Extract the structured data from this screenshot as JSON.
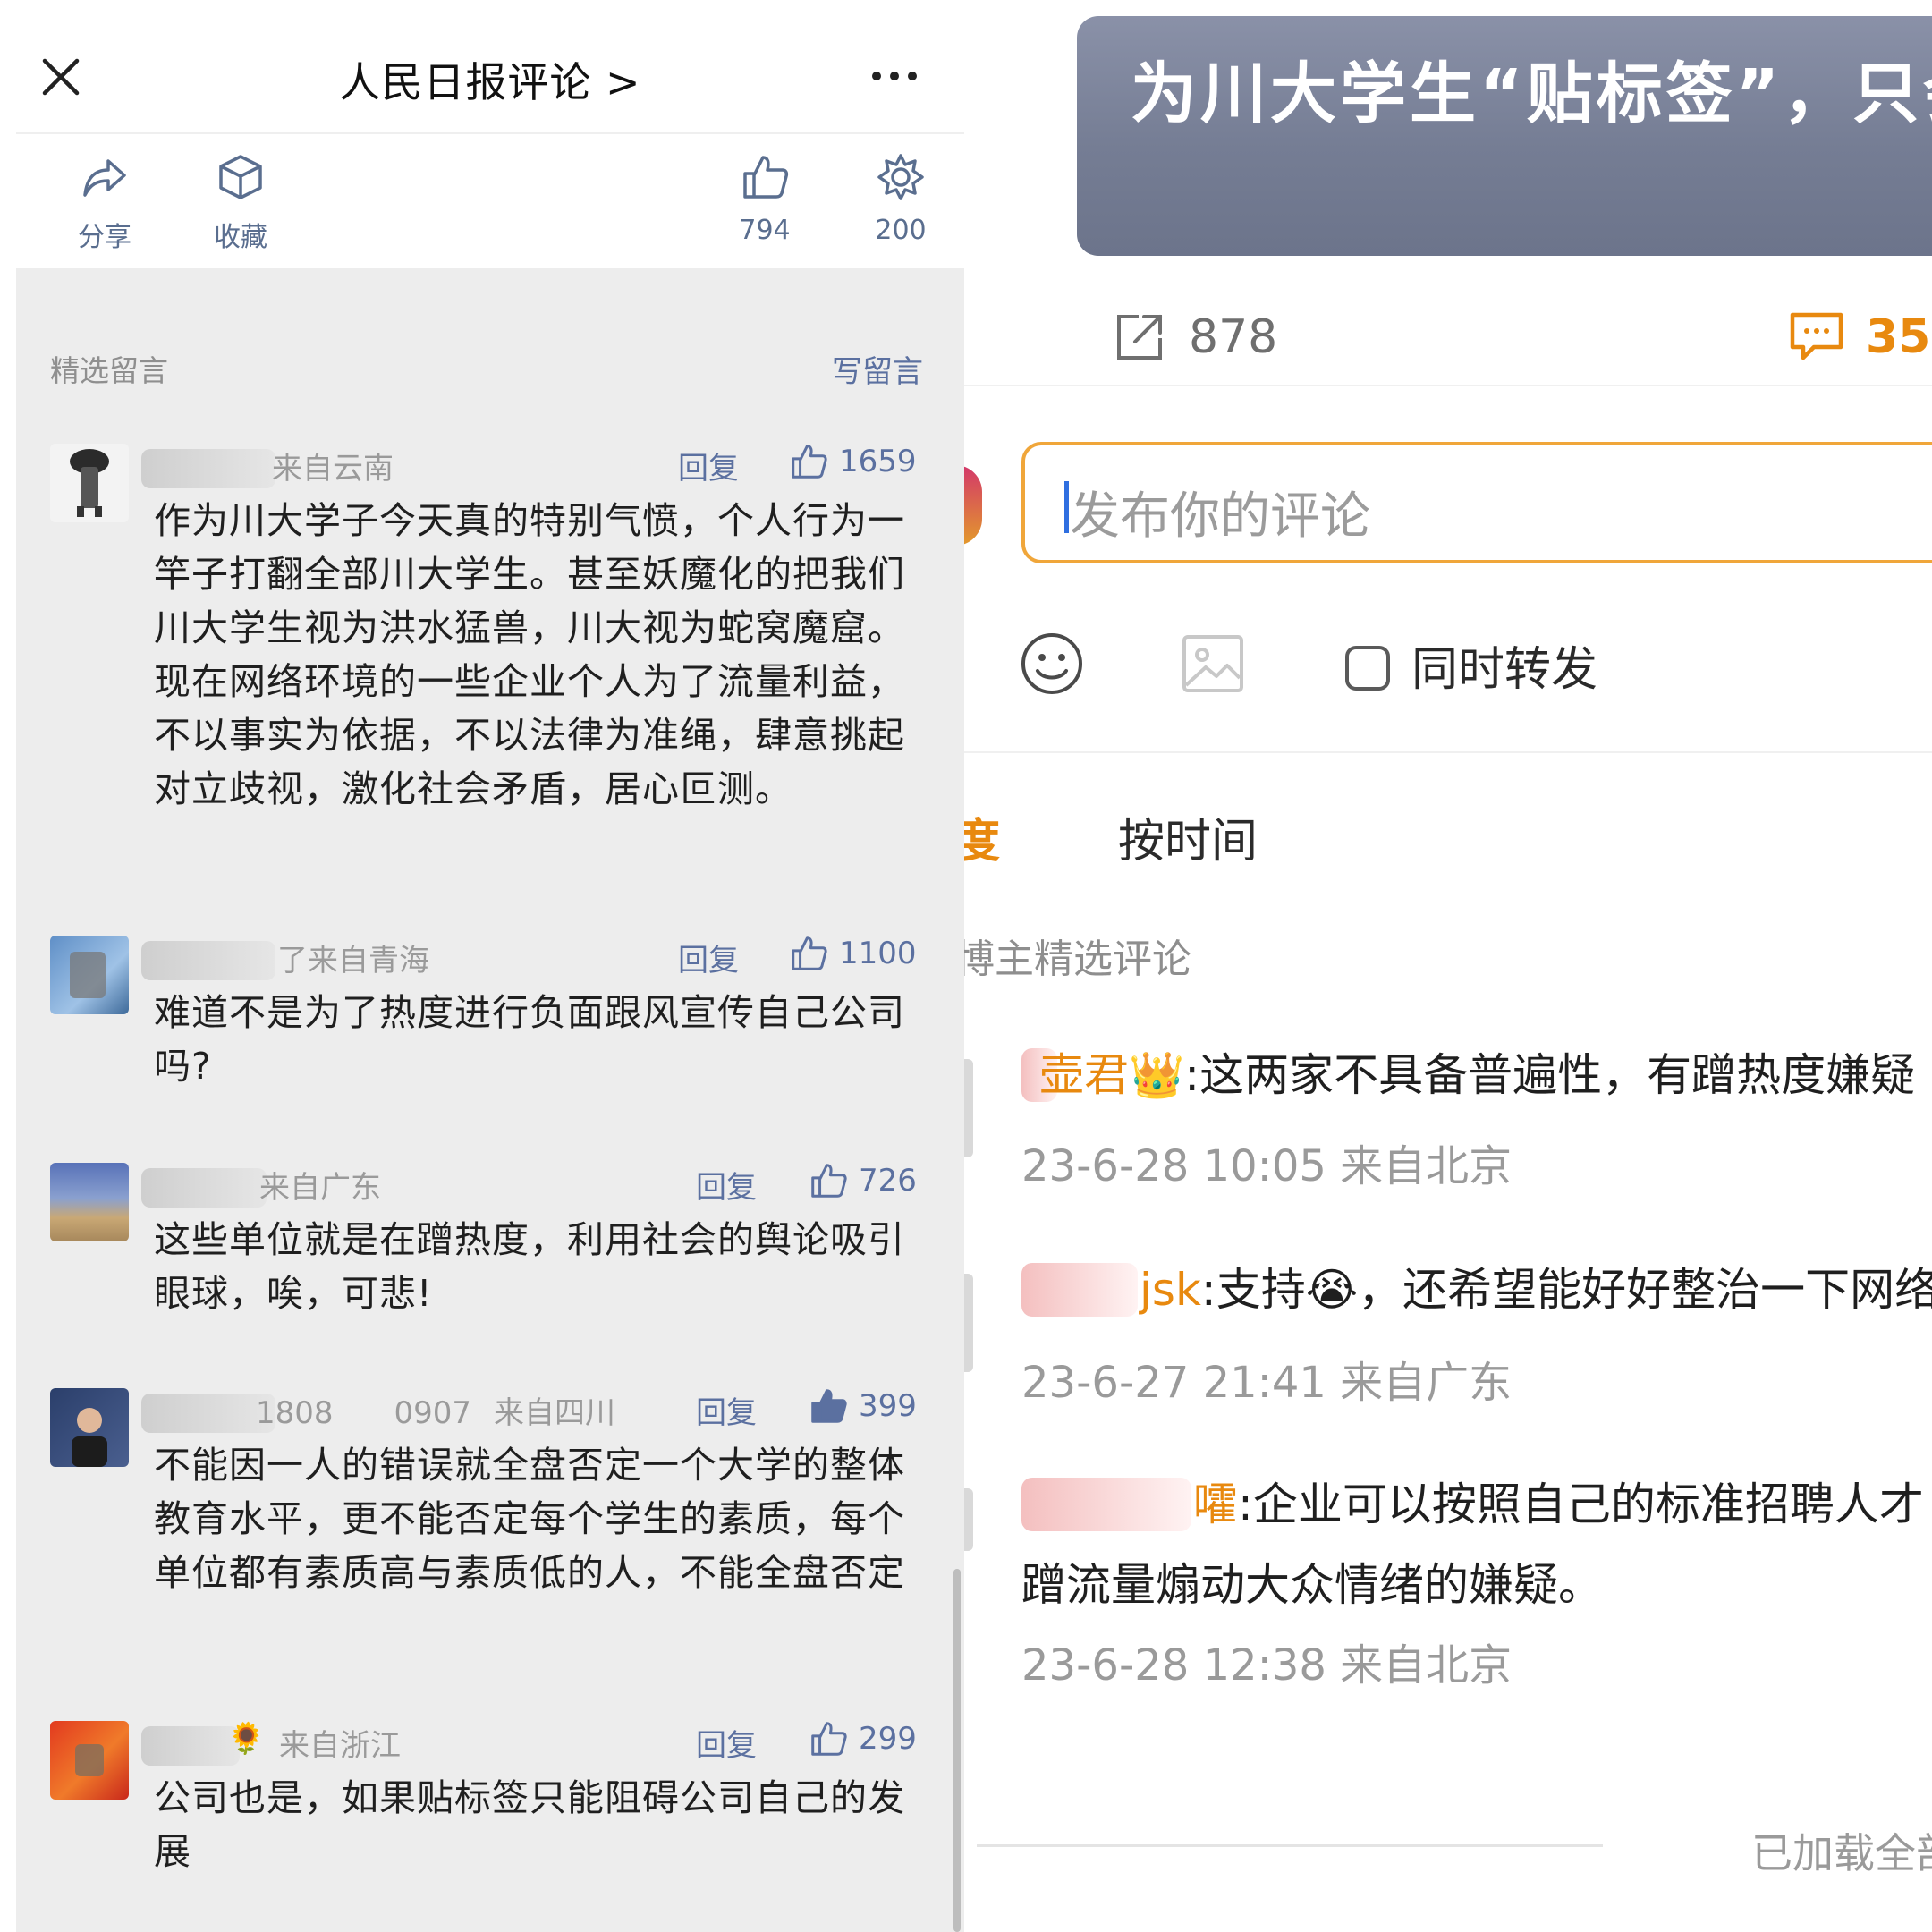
{
  "left": {
    "header": {
      "title": "人民日报评论 >"
    },
    "actions": [
      {
        "label": "分享",
        "icon": "share-icon"
      },
      {
        "label": "收藏",
        "icon": "cube-icon"
      },
      {
        "label": "794",
        "icon": "thumbs-up-icon"
      },
      {
        "label": "200",
        "icon": "flower-icon"
      }
    ],
    "section_title": "精选留言",
    "write_label": "写留言",
    "reply_label": "回复",
    "comments": [
      {
        "name": "",
        "region": "来自云南",
        "likes": "1659",
        "liked": false,
        "text": "作为川大学子今天真的特别气愤，个人行为一竿子打翻全部川大学生。甚至妖魔化的把我们川大学生视为洪水猛兽，川大视为蛇窝魔窟。现在网络环境的一些企业个人为了流量利益，不以事实为依据，不以法律为准绳，肆意挑起对立歧视，激化社会矛盾，居心叵测。"
      },
      {
        "name": "了",
        "region": "来自青海",
        "likes": "1100",
        "liked": false,
        "text": "难道不是为了热度进行负面跟风宣传自己公司吗?"
      },
      {
        "name": "",
        "region": "来自广东",
        "likes": "726",
        "liked": false,
        "text": "这些单位就是在蹭热度，利用社会的舆论吸引眼球，唉，可悲!"
      },
      {
        "name": "1808　　0907",
        "region": "来自四川",
        "likes": "399",
        "liked": true,
        "text": "不能因一人的错误就全盘否定一个大学的整体教育水平，更不能否定每个学生的素质，每个单位都有素质高与素质低的人，不能全盘否定"
      },
      {
        "name": "🌻",
        "region": "来自浙江",
        "likes": "299",
        "liked": false,
        "text": "公司也是，如果贴标签只能阻碍公司自己的发展"
      }
    ]
  },
  "right": {
    "video_title": "为川大学生“贴标签”，只会见",
    "repost_count": "878",
    "comment_count": "35",
    "input_placeholder": "发布你的评论",
    "forward_label": "同时转发",
    "sort_hot": "度",
    "sort_time": "按时间",
    "selected_heading": "博主精选评论",
    "comments": [
      {
        "user": "壶君",
        "badge": "👑",
        "text": ":这两家不具备普遍性，有蹭热度嫌疑",
        "cont": "",
        "meta": "23-6-28 10:05 来自北京"
      },
      {
        "user": "jsk",
        "badge": "",
        "text": ":支持😭，还希望能好好整治一下网络",
        "cont": "",
        "meta": "23-6-27 21:41 来自广东"
      },
      {
        "user": "嚯",
        "badge": "",
        "text": ":企业可以按照自己的标准招聘人才",
        "cont": "蹭流量煽动大众情绪的嫌疑。",
        "meta": "23-6-28 12:38 来自北京"
      }
    ],
    "loaded_text": "已加载全部"
  },
  "colors": {
    "accent_orange": "#e8890f",
    "link_blue": "#5b70a0",
    "input_border": "#f0a63a"
  }
}
